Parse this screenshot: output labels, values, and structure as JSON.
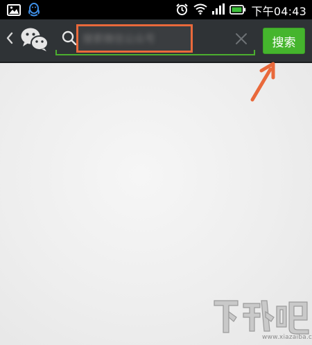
{
  "status_bar": {
    "time": "下午04:43",
    "icons": [
      "image-notification-icon",
      "qq-icon",
      "alarm-icon",
      "wifi-icon",
      "signal-icon",
      "battery-icon"
    ]
  },
  "header": {
    "icons": [
      "back-chevron-icon",
      "wechat-logo-icon",
      "search-icon",
      "clear-icon"
    ],
    "search": {
      "value": "",
      "placeholder": "搜索微信公众号"
    },
    "search_button_label": "搜索"
  },
  "annotation": {
    "highlight_color": "#e9693b",
    "arrow_color": "#e9693b"
  },
  "watermark": {
    "logo": "下载吧",
    "text": "www.xiazaiba.com"
  },
  "colors": {
    "accent_green": "#45b52d",
    "header_bg": "#2f3336",
    "content_bg": "#eeeeee"
  }
}
